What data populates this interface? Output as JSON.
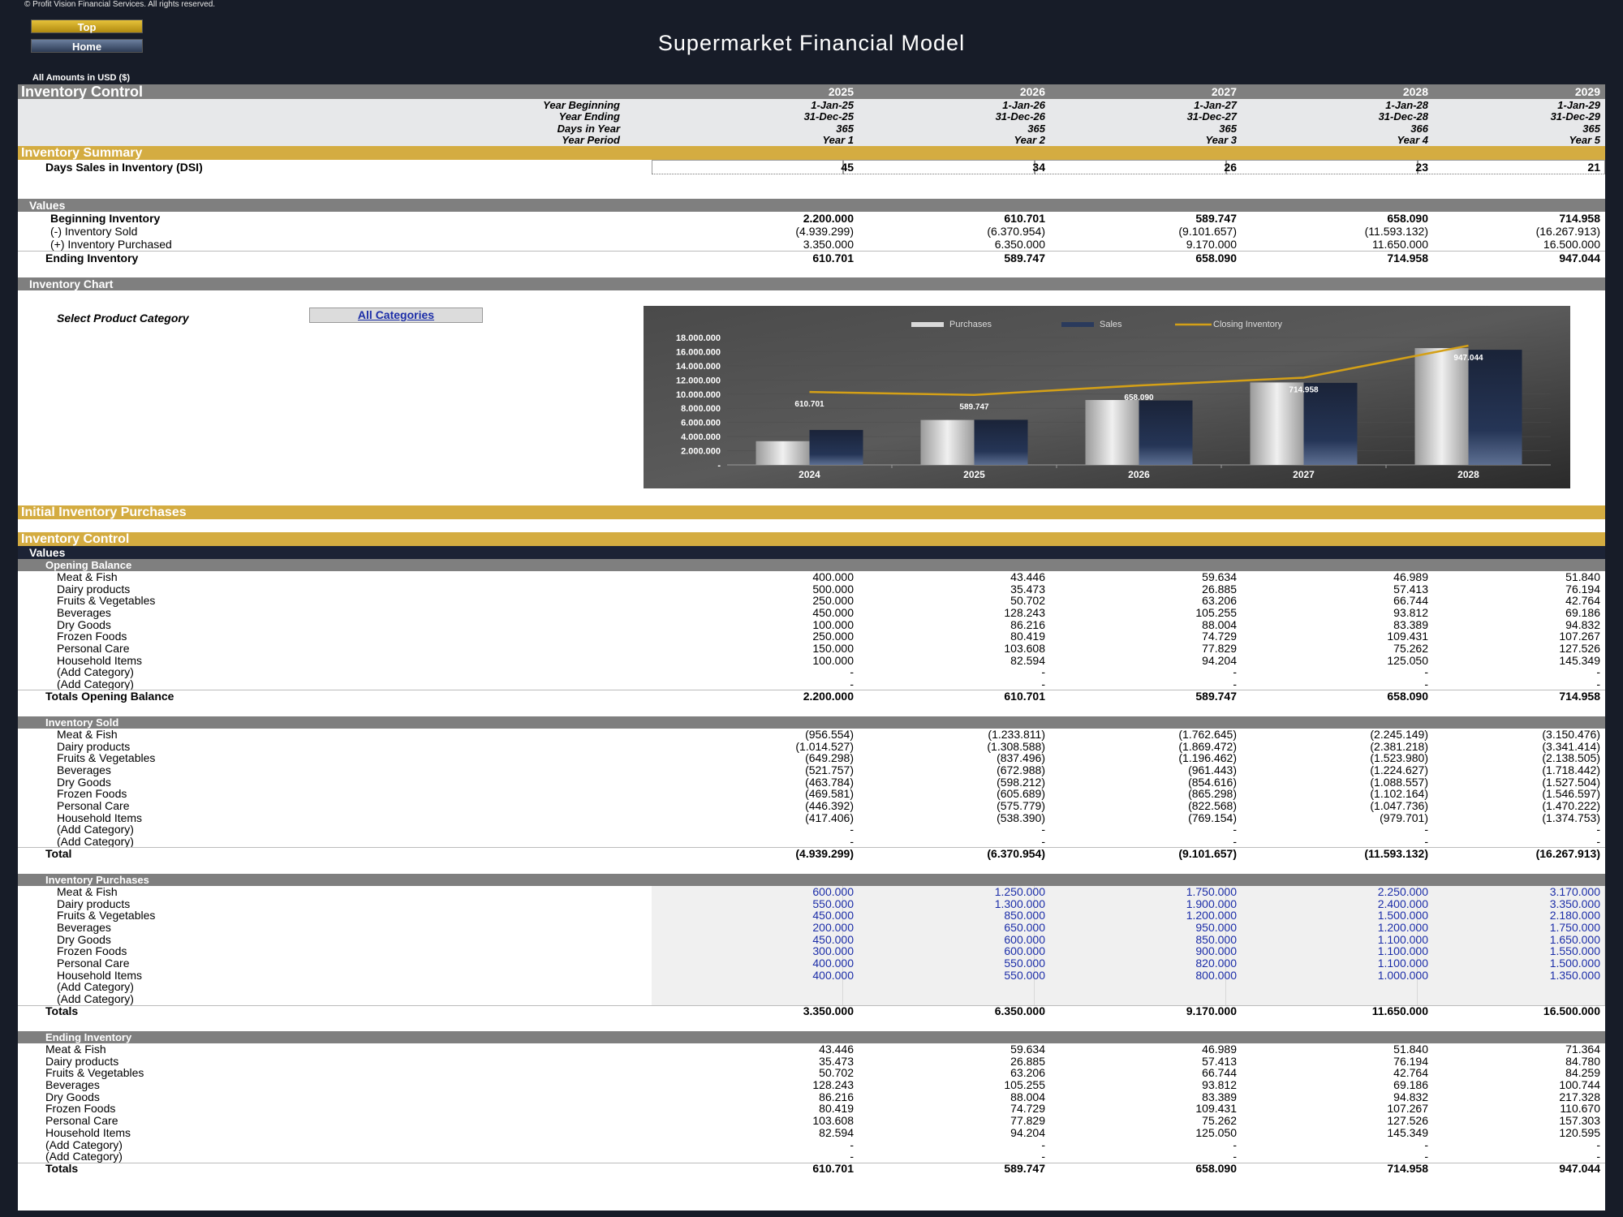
{
  "copyright": "© Profit Vision Financial Services. All rights reserved.",
  "nav": {
    "top_label": "Top",
    "home_label": "Home"
  },
  "app_title": "Supermarket Financial Model",
  "amounts_note": "All Amounts in  USD ($)",
  "header": {
    "title": "Inventory Control",
    "years": [
      "2025",
      "2026",
      "2027",
      "2028",
      "2029"
    ],
    "meta": [
      {
        "label": "Year Beginning",
        "values": [
          "1-Jan-25",
          "1-Jan-26",
          "1-Jan-27",
          "1-Jan-28",
          "1-Jan-29"
        ]
      },
      {
        "label": "Year Ending",
        "values": [
          "31-Dec-25",
          "31-Dec-26",
          "31-Dec-27",
          "31-Dec-28",
          "31-Dec-29"
        ]
      },
      {
        "label": "Days in Year",
        "values": [
          "365",
          "365",
          "365",
          "366",
          "365"
        ]
      },
      {
        "label": "Year Period",
        "values": [
          "Year 1",
          "Year 2",
          "Year 3",
          "Year 4",
          "Year 5"
        ]
      }
    ]
  },
  "summary": {
    "title": "Inventory Summary",
    "dsi_label": "Days Sales in Inventory (DSI)",
    "dsi_values": [
      "45",
      "34",
      "26",
      "23",
      "21"
    ]
  },
  "values_block": {
    "title": "Values",
    "rows": [
      {
        "label": "Beginning Inventory",
        "values": [
          "2.200.000",
          "610.701",
          "589.747",
          "658.090",
          "714.958"
        ]
      },
      {
        "label": "(-) Inventory Sold",
        "values": [
          "(4.939.299)",
          "(6.370.954)",
          "(9.101.657)",
          "(11.593.132)",
          "(16.267.913)"
        ]
      },
      {
        "label": "(+) Inventory Purchased",
        "values": [
          "3.350.000",
          "6.350.000",
          "9.170.000",
          "11.650.000",
          "16.500.000"
        ]
      },
      {
        "label": "Ending Inventory",
        "values": [
          "610.701",
          "589.747",
          "658.090",
          "714.958",
          "947.044"
        ]
      }
    ]
  },
  "chart_section": {
    "title": "Inventory Chart",
    "select_label": "Select Product Category",
    "select_value": "All Categories"
  },
  "chart_data": {
    "type": "bar",
    "categories": [
      "2024",
      "2025",
      "2026",
      "2027",
      "2028"
    ],
    "series": [
      {
        "name": "Purchases",
        "kind": "bar",
        "values": [
          3350000,
          6350000,
          9170000,
          11650000,
          16500000
        ]
      },
      {
        "name": "Sales",
        "kind": "bar",
        "values": [
          4939299,
          6370954,
          9101657,
          11593132,
          16267913
        ]
      },
      {
        "name": "Closing Inventory",
        "kind": "line",
        "values": [
          610701,
          589747,
          658090,
          714958,
          947044
        ]
      }
    ],
    "data_labels": [
      "610.701",
      "589.747",
      "658.090",
      "714.958",
      "947.044"
    ],
    "y_ticks": [
      "-",
      "2.000.000",
      "4.000.000",
      "6.000.000",
      "8.000.000",
      "10.000.000",
      "12.000.000",
      "14.000.000",
      "16.000.000",
      "18.000.000"
    ],
    "ylim": [
      0,
      18000000
    ],
    "legend_position": "top",
    "colors": {
      "purchases": "#d9d9d9",
      "sales": "#1c2a45",
      "closing": "#d4a017",
      "background": "#3a3a3a"
    }
  },
  "initial_purchases": {
    "title": "Initial Inventory Purchases"
  },
  "control": {
    "title": "Inventory Control",
    "values_title": "Values",
    "opening": {
      "title": "Opening Balance",
      "rows": [
        {
          "label": "Meat & Fish",
          "values": [
            "400.000",
            "43.446",
            "59.634",
            "46.989",
            "51.840"
          ]
        },
        {
          "label": "Dairy products",
          "values": [
            "500.000",
            "35.473",
            "26.885",
            "57.413",
            "76.194"
          ]
        },
        {
          "label": "Fruits & Vegetables",
          "values": [
            "250.000",
            "50.702",
            "63.206",
            "66.744",
            "42.764"
          ]
        },
        {
          "label": "Beverages",
          "values": [
            "450.000",
            "128.243",
            "105.255",
            "93.812",
            "69.186"
          ]
        },
        {
          "label": "Dry Goods",
          "values": [
            "100.000",
            "86.216",
            "88.004",
            "83.389",
            "94.832"
          ]
        },
        {
          "label": "Frozen Foods",
          "values": [
            "250.000",
            "80.419",
            "74.729",
            "109.431",
            "107.267"
          ]
        },
        {
          "label": "Personal Care",
          "values": [
            "150.000",
            "103.608",
            "77.829",
            "75.262",
            "127.526"
          ]
        },
        {
          "label": "Household Items",
          "values": [
            "100.000",
            "82.594",
            "94.204",
            "125.050",
            "145.349"
          ]
        },
        {
          "label": "(Add Category)",
          "values": [
            "-",
            "-",
            "-",
            "-",
            "-"
          ]
        },
        {
          "label": "(Add Category)",
          "values": [
            "-",
            "-",
            "-",
            "-",
            "-"
          ]
        }
      ],
      "total_label": "Totals Opening Balance",
      "totals": [
        "2.200.000",
        "610.701",
        "589.747",
        "658.090",
        "714.958"
      ]
    },
    "sold": {
      "title": "Inventory Sold",
      "rows": [
        {
          "label": "Meat & Fish",
          "values": [
            "(956.554)",
            "(1.233.811)",
            "(1.762.645)",
            "(2.245.149)",
            "(3.150.476)"
          ]
        },
        {
          "label": "Dairy products",
          "values": [
            "(1.014.527)",
            "(1.308.588)",
            "(1.869.472)",
            "(2.381.218)",
            "(3.341.414)"
          ]
        },
        {
          "label": "Fruits & Vegetables",
          "values": [
            "(649.298)",
            "(837.496)",
            "(1.196.462)",
            "(1.523.980)",
            "(2.138.505)"
          ]
        },
        {
          "label": "Beverages",
          "values": [
            "(521.757)",
            "(672.988)",
            "(961.443)",
            "(1.224.627)",
            "(1.718.442)"
          ]
        },
        {
          "label": "Dry Goods",
          "values": [
            "(463.784)",
            "(598.212)",
            "(854.616)",
            "(1.088.557)",
            "(1.527.504)"
          ]
        },
        {
          "label": "Frozen Foods",
          "values": [
            "(469.581)",
            "(605.689)",
            "(865.298)",
            "(1.102.164)",
            "(1.546.597)"
          ]
        },
        {
          "label": "Personal Care",
          "values": [
            "(446.392)",
            "(575.779)",
            "(822.568)",
            "(1.047.736)",
            "(1.470.222)"
          ]
        },
        {
          "label": "Household Items",
          "values": [
            "(417.406)",
            "(538.390)",
            "(769.154)",
            "(979.701)",
            "(1.374.753)"
          ]
        },
        {
          "label": "(Add Category)",
          "values": [
            "-",
            "-",
            "-",
            "-",
            "-"
          ]
        },
        {
          "label": "(Add Category)",
          "values": [
            "-",
            "-",
            "-",
            "-",
            "-"
          ]
        }
      ],
      "total_label": "Total",
      "totals": [
        "(4.939.299)",
        "(6.370.954)",
        "(9.101.657)",
        "(11.593.132)",
        "(16.267.913)"
      ]
    },
    "purchases": {
      "title": "Inventory Purchases",
      "rows": [
        {
          "label": "Meat & Fish",
          "values": [
            "600.000",
            "1.250.000",
            "1.750.000",
            "2.250.000",
            "3.170.000"
          ]
        },
        {
          "label": "Dairy products",
          "values": [
            "550.000",
            "1.300.000",
            "1.900.000",
            "2.400.000",
            "3.350.000"
          ]
        },
        {
          "label": "Fruits & Vegetables",
          "values": [
            "450.000",
            "850.000",
            "1.200.000",
            "1.500.000",
            "2.180.000"
          ]
        },
        {
          "label": "Beverages",
          "values": [
            "200.000",
            "650.000",
            "950.000",
            "1.200.000",
            "1.750.000"
          ]
        },
        {
          "label": "Dry Goods",
          "values": [
            "450.000",
            "600.000",
            "850.000",
            "1.100.000",
            "1.650.000"
          ]
        },
        {
          "label": "Frozen Foods",
          "values": [
            "300.000",
            "600.000",
            "900.000",
            "1.100.000",
            "1.550.000"
          ]
        },
        {
          "label": "Personal Care",
          "values": [
            "400.000",
            "550.000",
            "820.000",
            "1.100.000",
            "1.500.000"
          ]
        },
        {
          "label": "Household Items",
          "values": [
            "400.000",
            "550.000",
            "800.000",
            "1.000.000",
            "1.350.000"
          ]
        },
        {
          "label": "(Add Category)",
          "values": [
            "",
            "",
            "",
            "",
            ""
          ]
        },
        {
          "label": "(Add Category)",
          "values": [
            "",
            "",
            "",
            "",
            ""
          ]
        }
      ],
      "total_label": "Totals",
      "totals": [
        "3.350.000",
        "6.350.000",
        "9.170.000",
        "11.650.000",
        "16.500.000"
      ]
    },
    "ending": {
      "title": "Ending Inventory",
      "rows": [
        {
          "label": "Meat & Fish",
          "values": [
            "43.446",
            "59.634",
            "46.989",
            "51.840",
            "71.364"
          ]
        },
        {
          "label": "Dairy products",
          "values": [
            "35.473",
            "26.885",
            "57.413",
            "76.194",
            "84.780"
          ]
        },
        {
          "label": "Fruits & Vegetables",
          "values": [
            "50.702",
            "63.206",
            "66.744",
            "42.764",
            "84.259"
          ]
        },
        {
          "label": "Beverages",
          "values": [
            "128.243",
            "105.255",
            "93.812",
            "69.186",
            "100.744"
          ]
        },
        {
          "label": "Dry Goods",
          "values": [
            "86.216",
            "88.004",
            "83.389",
            "94.832",
            "217.328"
          ]
        },
        {
          "label": "Frozen Foods",
          "values": [
            "80.419",
            "74.729",
            "109.431",
            "107.267",
            "110.670"
          ]
        },
        {
          "label": "Personal Care",
          "values": [
            "103.608",
            "77.829",
            "75.262",
            "127.526",
            "157.303"
          ]
        },
        {
          "label": "Household Items",
          "values": [
            "82.594",
            "94.204",
            "125.050",
            "145.349",
            "120.595"
          ]
        },
        {
          "label": "(Add Category)",
          "values": [
            "-",
            "-",
            "-",
            "-",
            "-"
          ]
        },
        {
          "label": "(Add Category)",
          "values": [
            "-",
            "-",
            "-",
            "-",
            "-"
          ]
        }
      ],
      "total_label": "Totals",
      "totals": [
        "610.701",
        "589.747",
        "658.090",
        "714.958",
        "947.044"
      ]
    }
  }
}
